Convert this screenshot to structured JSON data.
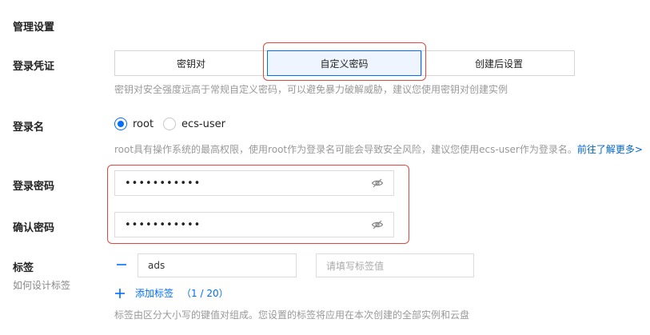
{
  "section_title": "管理设置",
  "login_credential": {
    "label": "登录凭证",
    "options": [
      "密钥对",
      "自定义密码",
      "创建后设置"
    ],
    "selected": "自定义密码",
    "hint": "密钥对安全强度远高于常规自定义密码，可以避免暴力破解威胁，建议您使用密钥对创建实例"
  },
  "login_name": {
    "label": "登录名",
    "options": [
      "root",
      "ecs-user"
    ],
    "selected": "root",
    "hint": "root具有操作系统的最高权限，使用root作为登录名可能会导致安全风险，建议您使用ecs-user作为登录名。",
    "hint_link": "前往了解更多>"
  },
  "login_password": {
    "label": "登录密码",
    "value": "•••••••••••"
  },
  "confirm_password": {
    "label": "确认密码",
    "value": "•••••••••••"
  },
  "tags": {
    "label": "标签",
    "sub_label": "如何设计标签",
    "key_value": "ads",
    "value_placeholder": "请填写标签值",
    "add_label": "添加标签",
    "count": "（1 / 20）",
    "hint": "标签由区分大小写的键值对组成。您设置的标签将应用在本次创建的全部实例和云盘"
  },
  "colors": {
    "accent": "#006eff",
    "highlight_border": "#e0483c"
  },
  "icons": [
    "eye-off-icon",
    "minus-icon",
    "plus-icon"
  ]
}
